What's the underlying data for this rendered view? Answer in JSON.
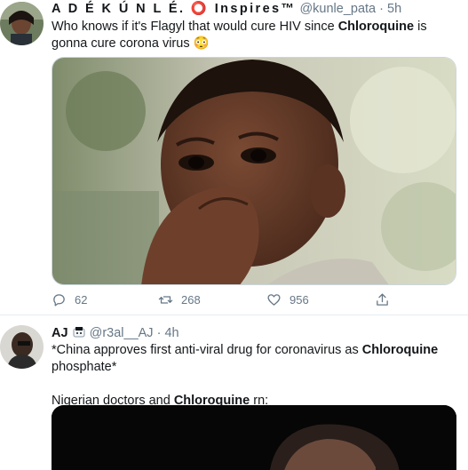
{
  "tweets": [
    {
      "author_name": "A D É K Ú N L É. ⭕ Inspires™",
      "handle": "@kunle_pata",
      "separator": "·",
      "time": "5h",
      "text_before": "Who knows if it's Flagyl that would cure HIV since ",
      "keyword": "Chloroquine",
      "text_after": " is gonna cure corona virus 😳",
      "actions": {
        "reply_count": "62",
        "retweet_count": "268",
        "like_count": "956"
      }
    },
    {
      "author_name": "AJ",
      "handle": "@r3al__AJ",
      "separator": "·",
      "time": "4h",
      "line1_before": "*China approves first anti-viral drug for coronavirus as ",
      "line1_keyword": "Chloroquine",
      "line1_after": " phosphate*",
      "line2_before": "Nigerian doctors and ",
      "line2_keyword": "Chloroquine",
      "line2_after": " rn:"
    }
  ],
  "colors": {
    "text": "#14171a",
    "meta": "#657786",
    "border": "#e6ecf0"
  }
}
